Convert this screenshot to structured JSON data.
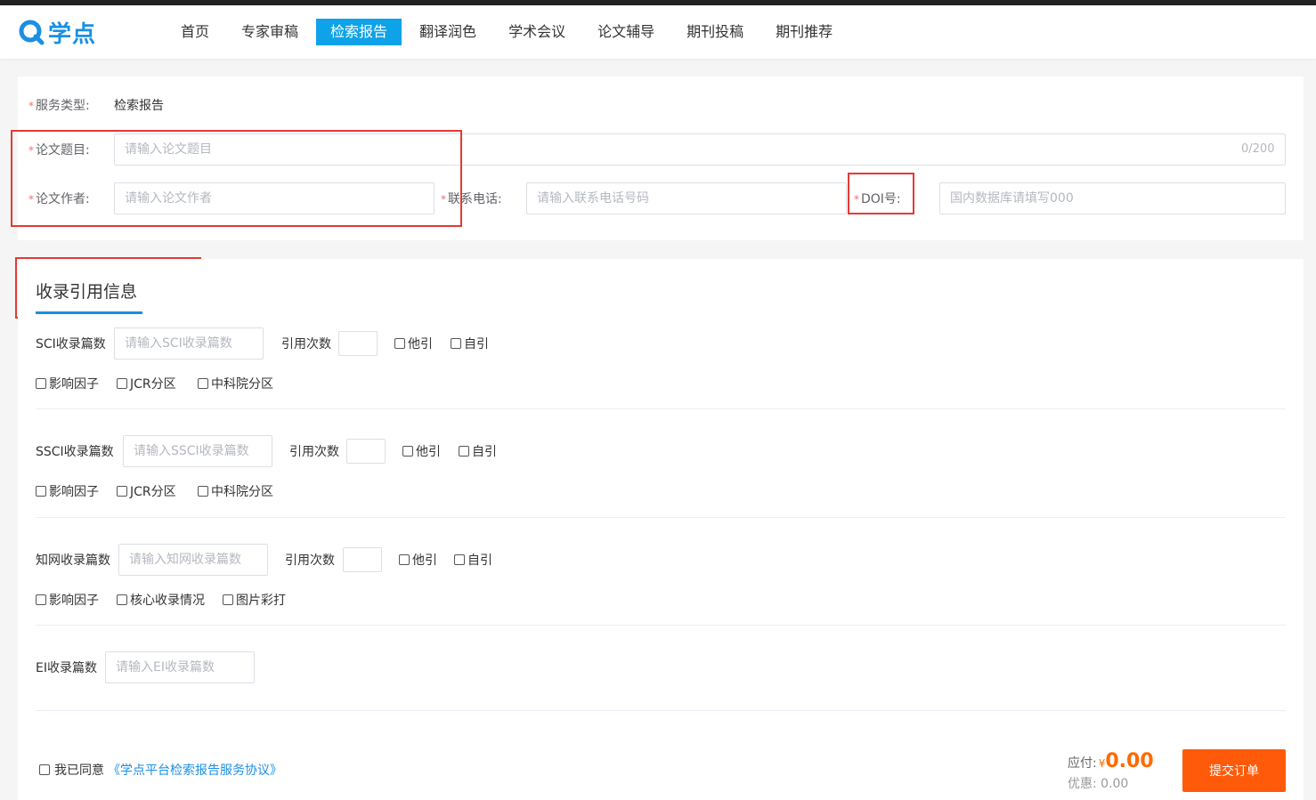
{
  "header": {
    "logo_text": "学点",
    "brand_color": "#1a8fe3",
    "nav": [
      {
        "label": "首页",
        "active": false
      },
      {
        "label": "专家审稿",
        "active": false
      },
      {
        "label": "检索报告",
        "active": true
      },
      {
        "label": "翻译润色",
        "active": false
      },
      {
        "label": "学术会议",
        "active": false
      },
      {
        "label": "论文辅导",
        "active": false
      },
      {
        "label": "期刊投稿",
        "active": false
      },
      {
        "label": "期刊推荐",
        "active": false
      }
    ]
  },
  "basic": {
    "required_mark": "*",
    "service_type_label": "服务类型:",
    "service_type_value": "检索报告",
    "title_label": "论文题目:",
    "title_placeholder": "请输入论文题目",
    "title_count": "0/200",
    "author_label": "论文作者:",
    "author_placeholder": "请输入论文作者",
    "phone_label": "联系电话:",
    "phone_placeholder": "请输入联系电话号码",
    "doi_label": "DOI号:",
    "doi_placeholder": "国内数据库请填写000"
  },
  "citation": {
    "title": "收录引用信息",
    "sci": {
      "label": "SCI收录篇数",
      "placeholder": "请输入SCI收录篇数",
      "cite_label": "引用次数",
      "other_cite": "他引",
      "self_cite": "自引",
      "impact": "影响因子",
      "jcr": "JCR分区",
      "cas": "中科院分区"
    },
    "ssci": {
      "label": "SSCI收录篇数",
      "placeholder": "请输入SSCI收录篇数",
      "cite_label": "引用次数",
      "other_cite": "他引",
      "self_cite": "自引",
      "impact": "影响因子",
      "jcr": "JCR分区",
      "cas": "中科院分区"
    },
    "cnki": {
      "label": "知网收录篇数",
      "placeholder": "请输入知网收录篇数",
      "cite_label": "引用次数",
      "other_cite": "他引",
      "self_cite": "自引",
      "impact": "影响因子",
      "core": "核心收录情况",
      "color_print": "图片彩打"
    },
    "ei": {
      "label": "EI收录篇数",
      "placeholder": "请输入EI收录篇数"
    }
  },
  "footer": {
    "agree_text": "我已同意",
    "agreement_link": "《学点平台检索报告服务协议》",
    "pay_label": "应付:",
    "currency": "¥",
    "pay_amount": "0.00",
    "discount_label": "优惠:",
    "discount_amount": "0.00",
    "submit_label": "提交订单",
    "submit_color": "#ff5a0a"
  }
}
